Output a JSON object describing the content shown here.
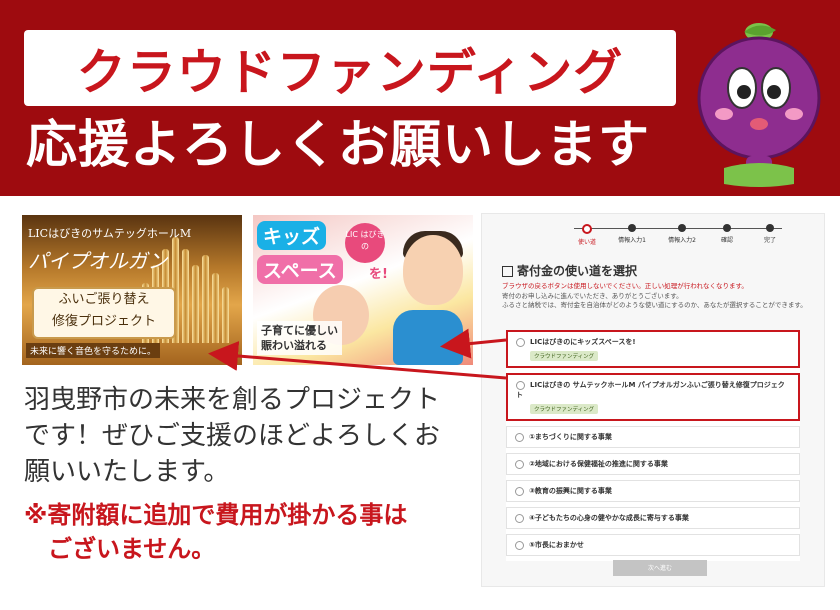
{
  "banner": {
    "title": "クラウドファンディング",
    "subtitle": "応援よろしくお願いします"
  },
  "thumbs": {
    "organ": {
      "tag": "LICはびきのサムテッグホールM",
      "name": "パイプオルガン",
      "ribbon_line1": "ふいご張り替え",
      "ribbon_line2": "修復プロジェクト",
      "foot": "未来に響く音色を守るために。"
    },
    "kids": {
      "badge_line1": "キッズ",
      "badge_line2": "スペース",
      "lic": "LIC はびきの",
      "wo": "を!",
      "caption_line1": "子育てに優しい",
      "caption_line2": "賑わい溢れる"
    }
  },
  "body": {
    "line1": "羽曳野市の未来を創るプロジェクト",
    "line2": "です！ぜひご支援のほどよろしくお",
    "line3": "願いいたします。",
    "note_line1": "※寄附額に追加で費用が掛かる事は",
    "note_line2": "　ございません。"
  },
  "screenshot": {
    "steps": [
      "使い道",
      "情報入力1",
      "情報入力2",
      "確認",
      "完了"
    ],
    "section_title": "寄付金の使い道を選択",
    "warning": "ブラウザの戻るボタンは使用しないでください。正しい処理が行われなくなります。",
    "info1": "寄付のお申し込みに進んでいただき、ありがとうございます。",
    "info2": "ふるさと納税では、寄付金を自治体がどのような使い道にするのか、あなたが選択することができます。",
    "options": [
      {
        "label": "LICはびきのにキッズスペースを!",
        "tag": "クラウドファンディング"
      },
      {
        "label": "LICはびきの サムテックホールM パイプオルガンふいご張り替え修復プロジェクト",
        "tag": "クラウドファンディング"
      },
      {
        "label": "①まちづくりに関する事業"
      },
      {
        "label": "②地域における保健福祉の推進に関する事業"
      },
      {
        "label": "③教育の振興に関する事業"
      },
      {
        "label": "④子どもたちの心身の健やかな成長に寄与する事業"
      },
      {
        "label": "⑤市長におまかせ"
      }
    ],
    "next_button": "次へ進む"
  },
  "colors": {
    "banner_red": "#9e0b0f",
    "accent_red": "#c8161d"
  }
}
